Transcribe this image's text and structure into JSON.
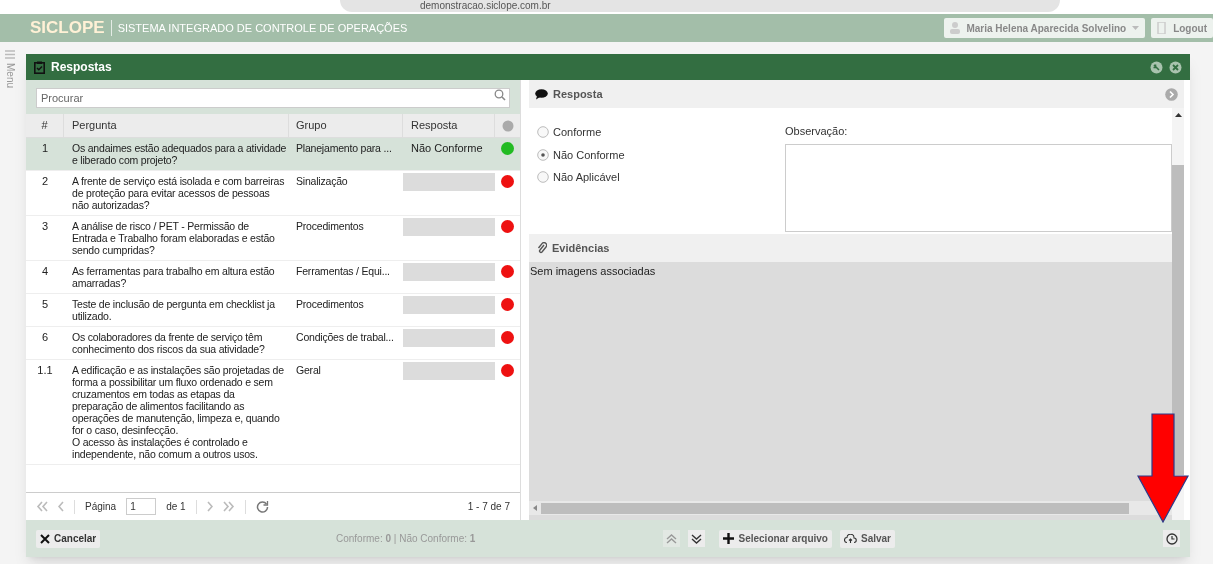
{
  "browser": {
    "url": "demonstracao.siclope.com.br"
  },
  "header": {
    "logo": "SICLOPE",
    "subtitle": "SISTEMA INTEGRADO DE CONTROLE DE OPERAÇÕES",
    "user": "Maria Helena Aparecida Solvelino",
    "logout": "Logout",
    "menu": "Menu"
  },
  "modal": {
    "title": "Respostas",
    "search": {
      "placeholder": "Procurar"
    },
    "table": {
      "columns": [
        "#",
        "Pergunta",
        "Grupo",
        "Resposta"
      ],
      "rows": [
        {
          "number": "1",
          "question": "Os andaimes estão adequados para a atividade e liberado com projeto?",
          "group": "Planejamento para ...",
          "answer": "Não Conforme",
          "color": "#22bb22",
          "selected": true
        },
        {
          "number": "2",
          "question": "A frente de serviço está isolada e com barreiras de proteção para evitar acessos de pessoas não autorizadas?",
          "group": "Sinalização",
          "color": "#ee1111",
          "selected": false
        },
        {
          "number": "3",
          "question": "A análise de risco / PET - Permissão de Entrada e Trabalho foram elaboradas e estão sendo cumpridas?",
          "group": "Procedimentos",
          "color": "#ee1111",
          "selected": false
        },
        {
          "number": "4",
          "question": "As ferramentas para trabalho em altura estão amarradas?",
          "group": "Ferramentas / Equi...",
          "color": "#ee1111",
          "selected": false
        },
        {
          "number": "5",
          "question": "Teste de inclusão de pergunta em checklist ja utilizado.",
          "group": "Procedimentos",
          "color": "#ee1111",
          "selected": false
        },
        {
          "number": "6",
          "question": "Os colaboradores da frente de serviço têm conhecimento dos riscos da sua atividade?",
          "group": "Condições de trabal...",
          "color": "#ee1111",
          "selected": false
        },
        {
          "number": "1.1",
          "question": "A edificação e as instalações são projetadas de forma a possibilitar um fluxo ordenado e sem cruzamentos em todas as etapas da preparação de alimentos facilitando as operações de manutenção, limpeza e, quando for o caso, desinfecção.\n                        O acesso às instalações é controlado e independente, não comum a outros usos.",
          "group": "Geral",
          "color": "#ee1111",
          "selected": false
        }
      ]
    },
    "pager": {
      "page_label": "Página",
      "page": "1",
      "of": "de 1",
      "range": "1 - 7 de 7"
    },
    "response": {
      "title": "Resposta",
      "options": [
        {
          "label": "Conforme",
          "selected": false
        },
        {
          "label": "Não Conforme",
          "selected": true
        },
        {
          "label": "Não Aplicável",
          "selected": false
        }
      ],
      "observation_label": "Observação:"
    },
    "evidence": {
      "title": "Evidências",
      "empty": "Sem imagens associadas"
    },
    "footer": {
      "cancel": "Cancelar",
      "summary": "Conforme: **0** | Não Conforme: **1**",
      "select_file": "Selecionar arquivo",
      "save": "Salvar"
    }
  }
}
